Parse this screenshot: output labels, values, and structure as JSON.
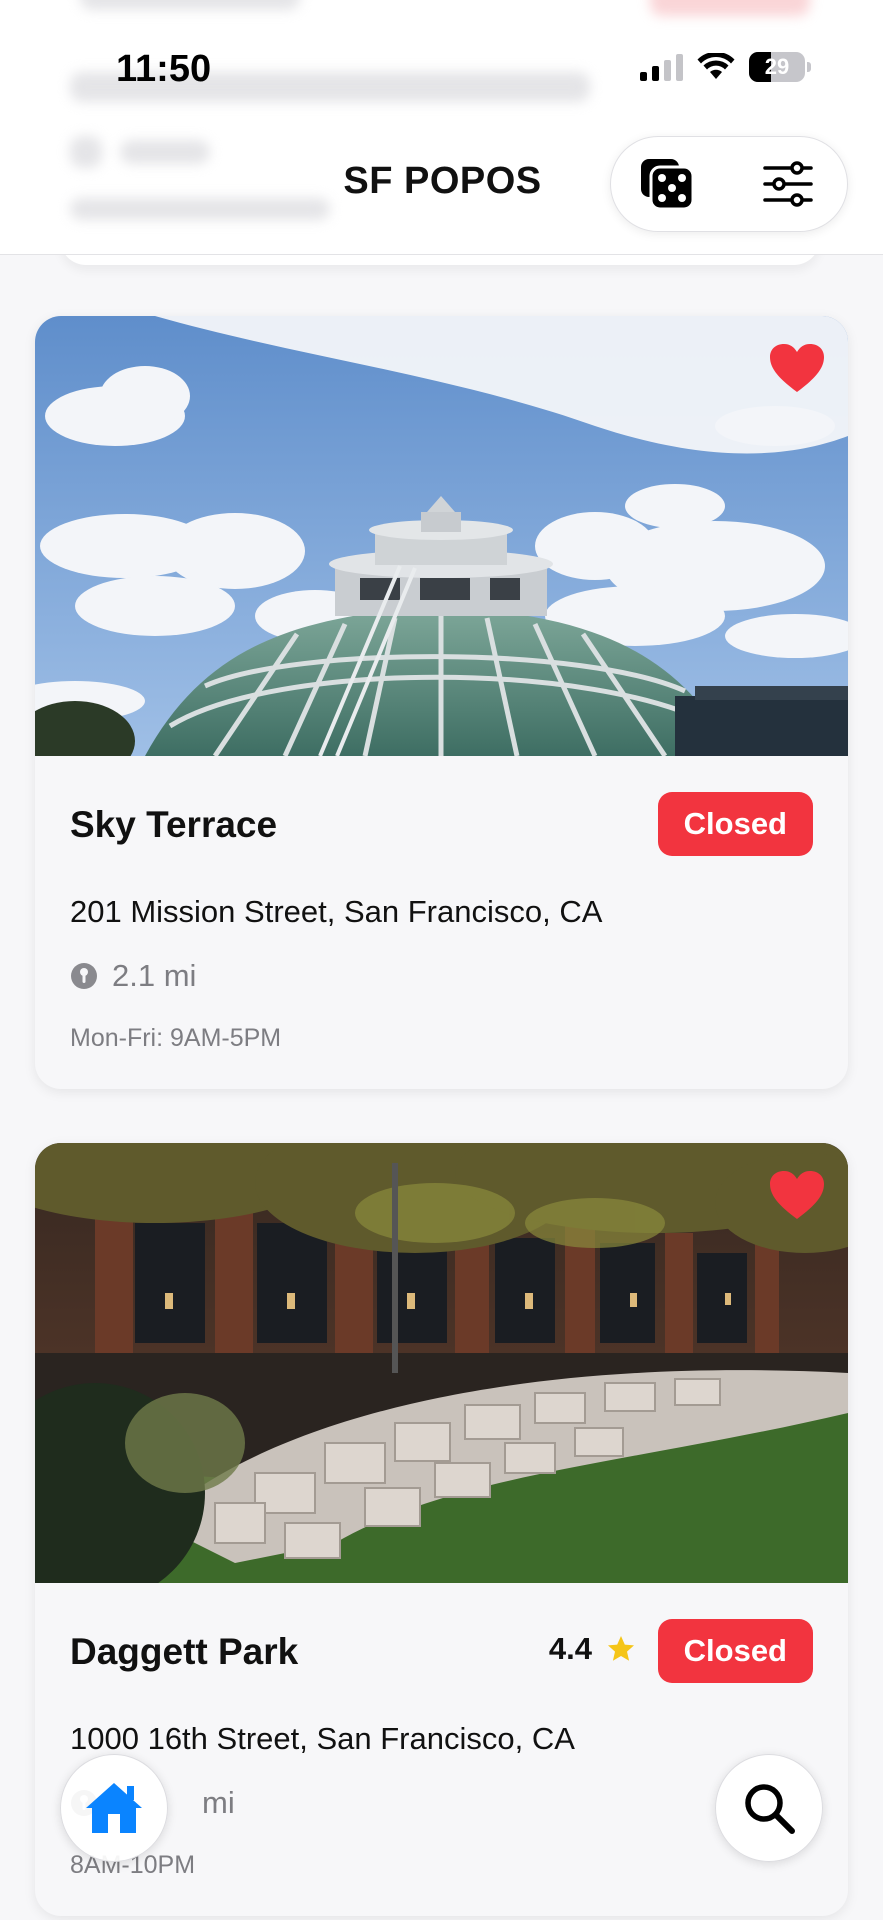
{
  "status_bar": {
    "time": "11:50",
    "battery": "29"
  },
  "header": {
    "title": "SF POPOS",
    "dice_icon": "dice-icon",
    "filter_icon": "sliders-icon"
  },
  "colors": {
    "closed_badge": "#f2343f",
    "heart": "#f2343f",
    "star": "#f5c518",
    "home_icon": "#0a84ff"
  },
  "cards": [
    {
      "name": "Sky Terrace",
      "status": "Closed",
      "address": "201 Mission Street, San Francisco, CA",
      "distance": "2.1 mi",
      "hours": "Mon-Fri: 9AM-5PM",
      "favorited": true
    },
    {
      "name": "Daggett Park",
      "rating": "4.4",
      "status": "Closed",
      "address": "1000 16th Street, San Francisco, CA",
      "distance": "mi",
      "hours": "8AM-10PM",
      "favorited": true
    }
  ],
  "tab_bar": {
    "home_icon": "house-icon",
    "search_icon": "search-icon"
  }
}
